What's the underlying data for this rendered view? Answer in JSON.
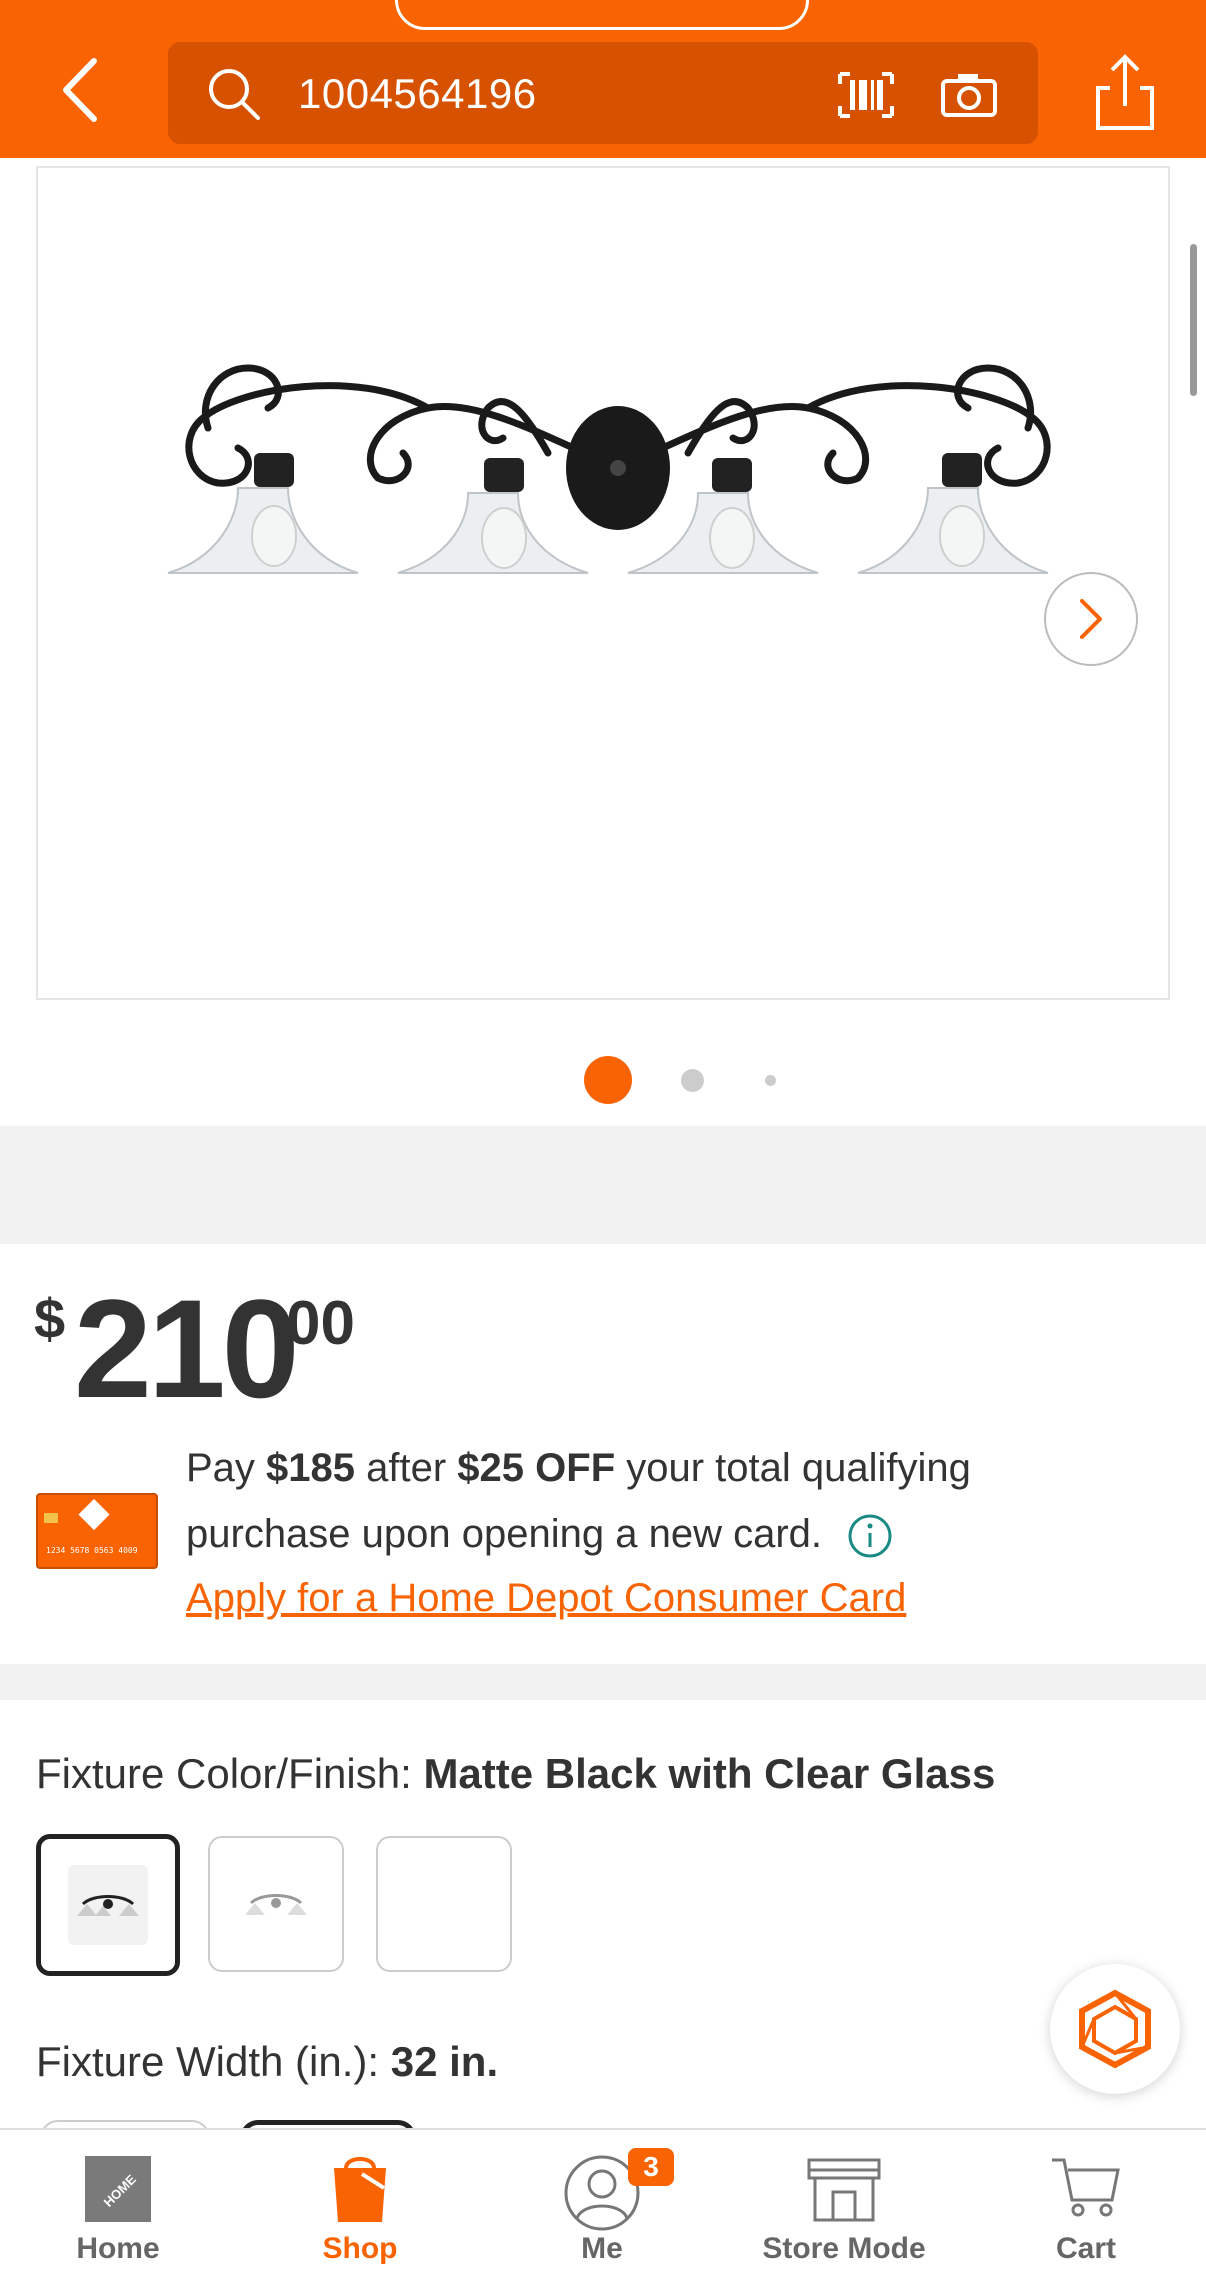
{
  "header": {
    "search_value": "1004564196",
    "icons": [
      "back-arrow-icon",
      "search-icon",
      "barcode-scanner-icon",
      "camera-icon",
      "share-icon"
    ],
    "color": "#f96302"
  },
  "gallery": {
    "image_count": 3,
    "active_index": 1,
    "icons": [
      "chevron-right-icon"
    ]
  },
  "price": {
    "currency": "$",
    "whole": "210",
    "cents": "00"
  },
  "promo": {
    "line1_prefix": "Pay ",
    "line1_amount": "$185",
    "line1_mid": " after ",
    "line1_discount": "$25 OFF",
    "line1_suffix": " your total qualifying",
    "line2": "purchase upon opening a new card.",
    "apply_link": "Apply for a Home Depot Consumer Card",
    "card_text": "1234 5678 0563 4009"
  },
  "options": {
    "color_label": "Fixture Color/Finish: ",
    "color_value": "Matte Black with Clear Glass",
    "width_label": "Fixture Width (in.): ",
    "width_value": "32 in."
  },
  "bottom_nav": {
    "items": [
      {
        "label": "Home",
        "icon": "home-depot-logo-icon"
      },
      {
        "label": "Shop",
        "icon": "shop-bucket-icon",
        "active": true
      },
      {
        "label": "Me",
        "icon": "user-icon",
        "badge": "3"
      },
      {
        "label": "Store Mode",
        "icon": "store-icon"
      },
      {
        "label": "Cart",
        "icon": "cart-icon"
      }
    ]
  },
  "colors": {
    "accent": "#f96302",
    "header_search_bg": "#d65201",
    "text": "#333333",
    "info_icon": "#1c8a84"
  }
}
